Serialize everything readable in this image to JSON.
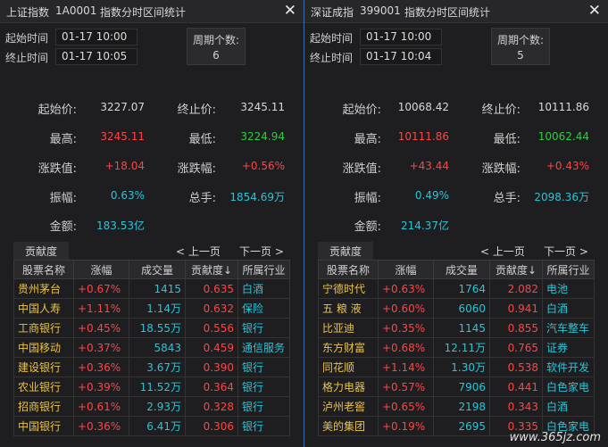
{
  "panels": [
    {
      "title_name": "上证指数",
      "title_code": "1A0001",
      "title_desc": "指数分时区间统计",
      "close_glyph": "✕",
      "start_label": "起始时间",
      "start_value": "01-17 10:00",
      "end_label": "终止时间",
      "end_value": "01-17 10:05",
      "period_label": "周期个数:",
      "period_value": "6",
      "stats": {
        "start_price_label": "起始价:",
        "start_price": "3227.07",
        "end_price_label": "终止价:",
        "end_price": "3245.11",
        "high_label": "最高:",
        "high": "3245.11",
        "low_label": "最低:",
        "low": "3224.94",
        "change_label": "涨跌值:",
        "change": "+18.04",
        "change_pct_label": "涨跌幅:",
        "change_pct": "+0.56%",
        "amplitude_label": "振幅:",
        "amplitude": "0.63%",
        "volume_label": "总手:",
        "volume": "1854.69万",
        "amount_label": "金额:",
        "amount": "183.53亿"
      },
      "contrib_label": "贡献度",
      "prev_page": "< 上一页",
      "next_page": "下一页 >",
      "headers": [
        "股票名称",
        "涨幅",
        "成交量",
        "贡献度↓",
        "所属行业"
      ],
      "rows": [
        [
          "贵州茅台",
          "+0.67%",
          "1415",
          "0.635",
          "白酒"
        ],
        [
          "中国人寿",
          "+1.11%",
          "1.14万",
          "0.632",
          "保险"
        ],
        [
          "工商银行",
          "+0.45%",
          "18.55万",
          "0.556",
          "银行"
        ],
        [
          "中国移动",
          "+0.37%",
          "5843",
          "0.459",
          "通信服务"
        ],
        [
          "建设银行",
          "+0.36%",
          "3.67万",
          "0.390",
          "银行"
        ],
        [
          "农业银行",
          "+0.39%",
          "11.52万",
          "0.364",
          "银行"
        ],
        [
          "招商银行",
          "+0.61%",
          "2.93万",
          "0.328",
          "银行"
        ],
        [
          "中国银行",
          "+0.36%",
          "6.41万",
          "0.306",
          "银行"
        ]
      ]
    },
    {
      "title_name": "深证成指",
      "title_code": "399001",
      "title_desc": "指数分时区间统计",
      "close_glyph": "✕",
      "start_label": "起始时间",
      "start_value": "01-17 10:00",
      "end_label": "终止时间",
      "end_value": "01-17 10:04",
      "period_label": "周期个数:",
      "period_value": "5",
      "stats": {
        "start_price_label": "起始价:",
        "start_price": "10068.42",
        "end_price_label": "终止价:",
        "end_price": "10111.86",
        "high_label": "最高:",
        "high": "10111.86",
        "low_label": "最低:",
        "low": "10062.44",
        "change_label": "涨跌值:",
        "change": "+43.44",
        "change_pct_label": "涨跌幅:",
        "change_pct": "+0.43%",
        "amplitude_label": "振幅:",
        "amplitude": "0.49%",
        "volume_label": "总手:",
        "volume": "2098.36万",
        "amount_label": "金额:",
        "amount": "214.37亿"
      },
      "contrib_label": "贡献度",
      "prev_page": "< 上一页",
      "next_page": "下一页 >",
      "headers": [
        "股票名称",
        "涨幅",
        "成交量",
        "贡献度↓",
        "所属行业"
      ],
      "rows": [
        [
          "宁德时代",
          "+0.63%",
          "1764",
          "2.082",
          "电池"
        ],
        [
          "五 粮 液",
          "+0.60%",
          "6060",
          "0.941",
          "白酒"
        ],
        [
          "比亚迪",
          "+0.35%",
          "1145",
          "0.855",
          "汽车整车"
        ],
        [
          "东方财富",
          "+0.68%",
          "12.11万",
          "0.765",
          "证券"
        ],
        [
          "同花顺",
          "+1.14%",
          "1.30万",
          "0.538",
          "软件开发"
        ],
        [
          "格力电器",
          "+0.57%",
          "7906",
          "0.441",
          "白色家电"
        ],
        [
          "泸州老窖",
          "+0.65%",
          "2198",
          "0.343",
          "白酒"
        ],
        [
          "美的集团",
          "+0.19%",
          "2695",
          "0.335",
          "白色家电"
        ]
      ]
    }
  ],
  "watermark": "www.365jz.com",
  "colors": {
    "up": "#ff4444",
    "down": "#2ecc40",
    "neutral": "#2bc4d6",
    "name": "#e8c24a",
    "accent": "#3a6ea5"
  }
}
